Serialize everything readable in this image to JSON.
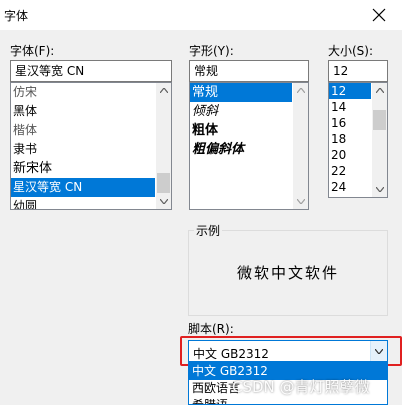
{
  "window": {
    "title": "字体"
  },
  "font": {
    "label": "字体(F):",
    "value": "星汉等宽 CN",
    "items": [
      "仿宋",
      "黑体",
      "楷体",
      "隶书",
      "新宋体",
      "星汉等宽 CN",
      "幼圆"
    ],
    "selected_index": 5
  },
  "style": {
    "label": "字形(Y):",
    "value": "常规",
    "items": [
      "常规",
      "倾斜",
      "粗体",
      "粗偏斜体"
    ],
    "selected_index": 0
  },
  "size": {
    "label": "大小(S):",
    "value": "12",
    "items": [
      "12",
      "14",
      "16",
      "18",
      "20",
      "22",
      "24"
    ],
    "selected_index": 0
  },
  "sample": {
    "label": "示例",
    "text": "微软中文软件"
  },
  "script": {
    "label": "脚本(R):",
    "value": "中文 GB2312",
    "options": [
      "中文 GB2312",
      "西欧语言",
      "希腊语"
    ],
    "selected_index": 0
  },
  "watermark": "CSDN @青灯照孽微",
  "colors": {
    "selection": "#0078d7",
    "highlight_box": "#e02020",
    "background": "#f0f0f0"
  }
}
